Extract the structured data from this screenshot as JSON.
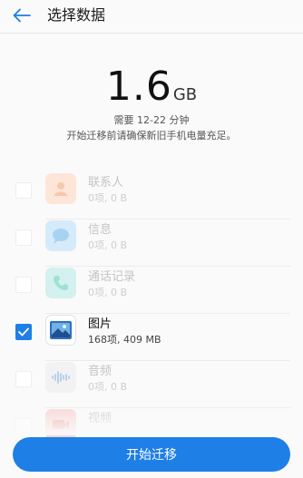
{
  "header": {
    "title": "选择数据"
  },
  "summary": {
    "size_value": "1.6",
    "size_unit": "GB",
    "time_text": "需要 12-22 分钟",
    "hint_text": "开始迁移前请确保新旧手机电量充足。"
  },
  "items": [
    {
      "label": "联系人",
      "count": "0项, 0 B",
      "checked": false,
      "icon": "contacts-icon",
      "color": "#f4a27a"
    },
    {
      "label": "信息",
      "count": "0项, 0 B",
      "checked": false,
      "icon": "message-icon",
      "color": "#4aa8e8"
    },
    {
      "label": "通话记录",
      "count": "0项, 0 B",
      "checked": false,
      "icon": "phone-icon",
      "color": "#40c4b8"
    },
    {
      "label": "图片",
      "count": "168项, 409 MB",
      "checked": true,
      "icon": "gallery-icon",
      "color": "#3a7bd5"
    },
    {
      "label": "音频",
      "count": "0项, 0 B",
      "checked": false,
      "icon": "audio-icon",
      "color": "#7aa8e0"
    },
    {
      "label": "视频",
      "count": "",
      "checked": false,
      "icon": "video-icon",
      "color": "#e0504a"
    }
  ],
  "footer": {
    "button_label": "开始迁移"
  }
}
